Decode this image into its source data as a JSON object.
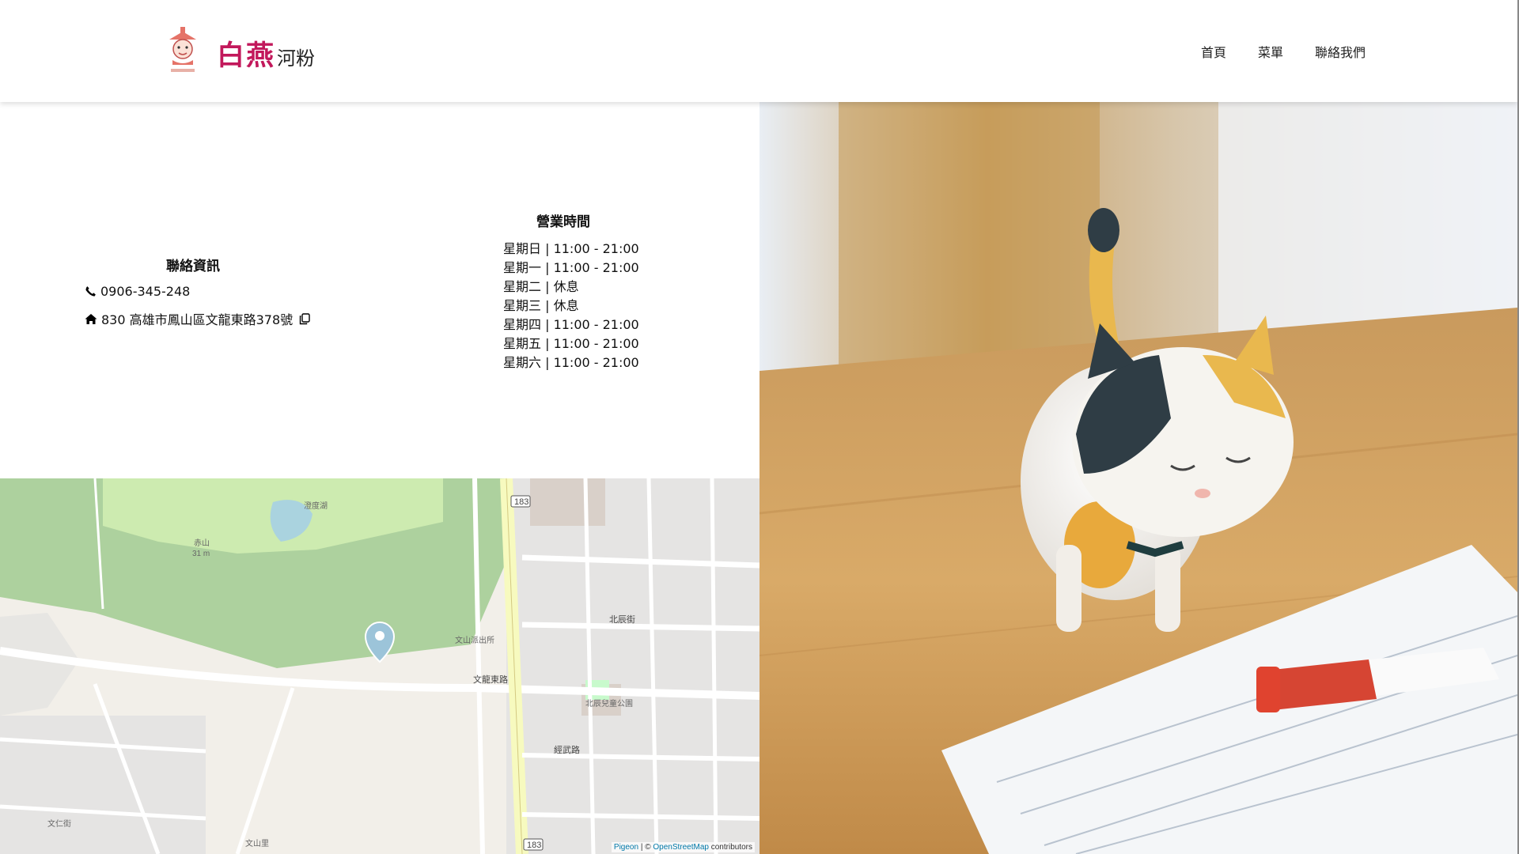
{
  "brand": {
    "name_main": "白燕",
    "name_sub": "河粉"
  },
  "nav": [
    {
      "label": "首頁"
    },
    {
      "label": "菜單"
    },
    {
      "label": "聯絡我們"
    }
  ],
  "contact": {
    "title": "聯絡資訊",
    "phone": "0906-345-248",
    "address": "830 高雄市鳳山區文龍東路378號"
  },
  "hours": {
    "title": "營業時間",
    "days": [
      "星期日 | 11:00 - 21:00",
      "星期一 | 11:00 - 21:00",
      "星期二 | 休息",
      "星期三 | 休息",
      "星期四 | 11:00 - 21:00",
      "星期五 | 11:00 - 21:00",
      "星期六 | 11:00 - 21:00"
    ]
  },
  "map": {
    "labels": {
      "pond": "澄度湖",
      "hill": "赤山",
      "hill_elev": "31 m",
      "road_wenlong": "文龍東路",
      "road_jingwu": "經武路",
      "road_beichen": "北辰街",
      "road_wenshan": "文山里",
      "park": "北辰兒童公園",
      "police": "文山派出所",
      "road_wenren": "文仁街",
      "route": "183"
    },
    "attribution": {
      "pigeon": "Pigeon",
      "sep": " | © ",
      "osm": "OpenStreetMap",
      "suffix": " contributors"
    }
  },
  "colors": {
    "brand": "#c2185b",
    "map_park": "#add19e",
    "map_road": "#ffffff",
    "map_major": "#f7fabf",
    "marker": "#9cc4d9"
  },
  "icons": {
    "phone": "phone-icon",
    "home": "home-icon",
    "copy": "copy-icon",
    "marker": "map-marker-icon"
  }
}
